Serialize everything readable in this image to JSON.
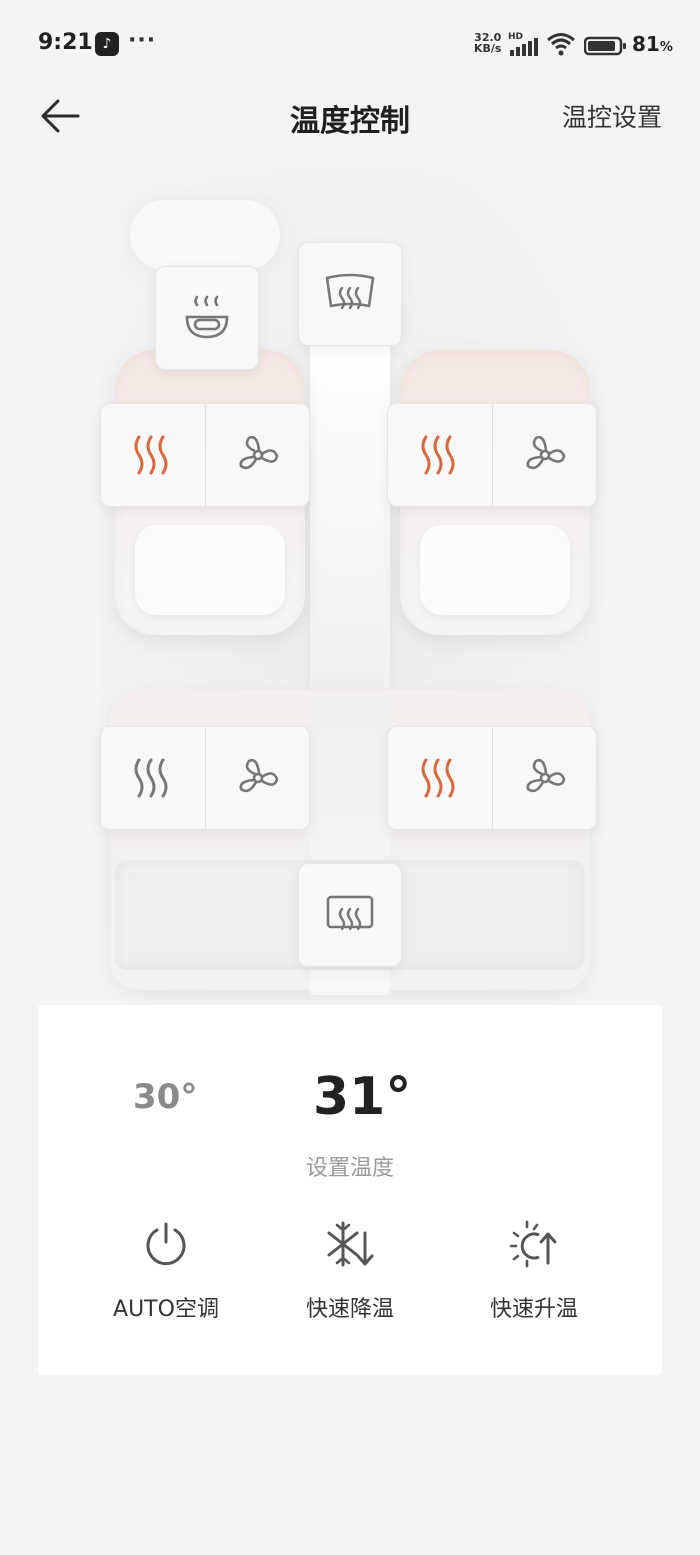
{
  "status_bar": {
    "time": "9:21",
    "network_speed_value": "32.0",
    "network_speed_unit": "KB/s",
    "network_type": "HD",
    "battery_percent": "81",
    "battery_unit": "%",
    "more_indicator": "···"
  },
  "header": {
    "title": "温度控制",
    "settings_label": "温控设置"
  },
  "car": {
    "front_left_seat": {
      "heat_active": true
    },
    "front_right_seat": {
      "heat_active": true
    },
    "rear_left_seat": {
      "heat_active": false
    },
    "rear_right_seat": {
      "heat_active": true
    },
    "colors": {
      "heat_active": "#d8693f",
      "icon_default": "#7a7a7a"
    }
  },
  "control": {
    "current_temp": "30°",
    "set_temp": "31°",
    "set_temp_label": "设置温度",
    "actions": [
      {
        "label": "AUTO空调",
        "icon": "power-icon"
      },
      {
        "label": "快速降温",
        "icon": "snowflake-down-icon"
      },
      {
        "label": "快速升温",
        "icon": "sun-up-icon"
      }
    ]
  }
}
